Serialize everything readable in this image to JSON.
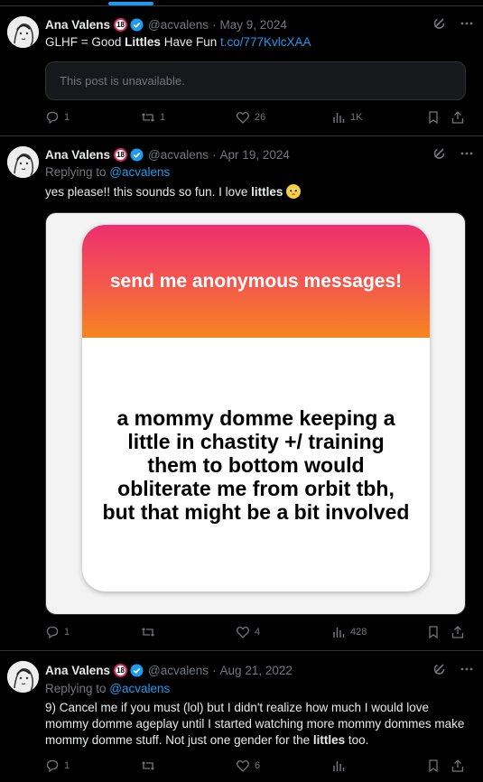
{
  "tweets": [
    {
      "author": "Ana Valens",
      "age_badge": "18",
      "handle": "@acvalens",
      "separator": "·",
      "date": "May 9, 2024",
      "text_parts": [
        "GLHF = Good ",
        "Littles",
        " Have Fun "
      ],
      "link": "t.co/777KvlcXAA",
      "unavailable_notice": "This post is unavailable.",
      "stats": {
        "replies": "1",
        "reposts": "1",
        "likes": "26",
        "views": "1K"
      }
    },
    {
      "author": "Ana Valens",
      "age_badge": "18",
      "handle": "@acvalens",
      "separator": "·",
      "date": "Apr 19, 2024",
      "replying_label": "Replying to ",
      "replying_handle": "@acvalens",
      "text_parts": [
        "yes please!! this sounds so fun. I love ",
        "littles"
      ],
      "media": {
        "card_title": "send me anonymous messages!",
        "card_message": "a mommy domme keeping a little in chastity +/ training them to bottom would obliterate me from orbit tbh, but that might be a bit involved"
      },
      "stats": {
        "replies": "1",
        "reposts": "",
        "likes": "4",
        "views": "428"
      }
    },
    {
      "author": "Ana Valens",
      "age_badge": "18",
      "handle": "@acvalens",
      "separator": "·",
      "date": "Aug 21, 2022",
      "replying_label": "Replying to ",
      "replying_handle": "@acvalens",
      "text_parts": [
        "9) Cancel me if you must (lol) but I didn't realize how much I would love mommy domme ageplay until I started watching more mommy dommes make mommy domme stuff. Not just one gender for the ",
        "littles",
        " too."
      ],
      "stats": {
        "replies": "1",
        "reposts": "",
        "likes": "6",
        "views": ""
      }
    }
  ],
  "colors": {
    "background": "#000000",
    "text": "#e7e9ea",
    "muted": "#71767b",
    "accent": "#1d9bf0",
    "border": "#2f3336"
  },
  "icons": [
    "grok-icon",
    "more-icon",
    "reply-icon",
    "repost-icon",
    "like-icon",
    "views-icon",
    "bookmark-icon",
    "share-icon",
    "verified-icon"
  ]
}
